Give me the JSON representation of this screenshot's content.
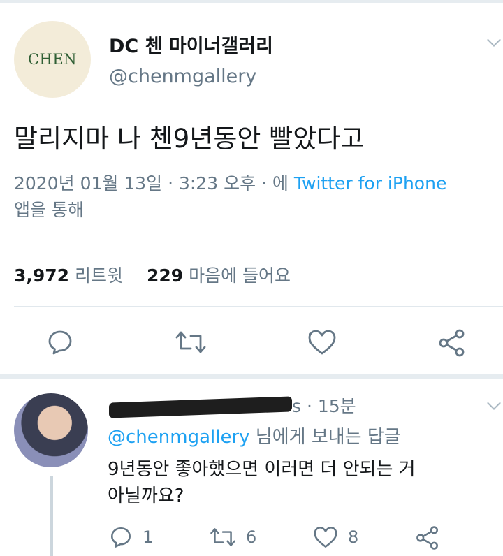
{
  "tweet": {
    "avatar_text": "CHEN",
    "display_name": "DC 첸 마이너갤러리",
    "handle": "@chenmgallery",
    "text": "말리지마 나 첸9년동안 빨았다고",
    "timestamp": "2020년 01월 13일 · 3:23 오후 · 에",
    "source": "Twitter for iPhone",
    "source_suffix": "앱을 통해",
    "stats": {
      "retweets_count": "3,972",
      "retweets_label": "리트윗",
      "likes_count": "229",
      "likes_label": "마음에 들어요"
    },
    "actions": [
      "reply-icon",
      "retweet-icon",
      "like-icon",
      "share-icon"
    ]
  },
  "reply": {
    "handle_suffix": "s · 15분",
    "replying_to": "@chenmgallery",
    "replying_label": "님에게 보내는 답글",
    "text_line1": "9년동안 좋아했으면 이러면 더 안되는  거",
    "text_line2": "아닐까요?",
    "reply_count": "1",
    "retweet_count": "6",
    "like_count": "8"
  },
  "colors": {
    "accent": "#1da1f2",
    "muted": "#657786",
    "text": "#14171a"
  }
}
